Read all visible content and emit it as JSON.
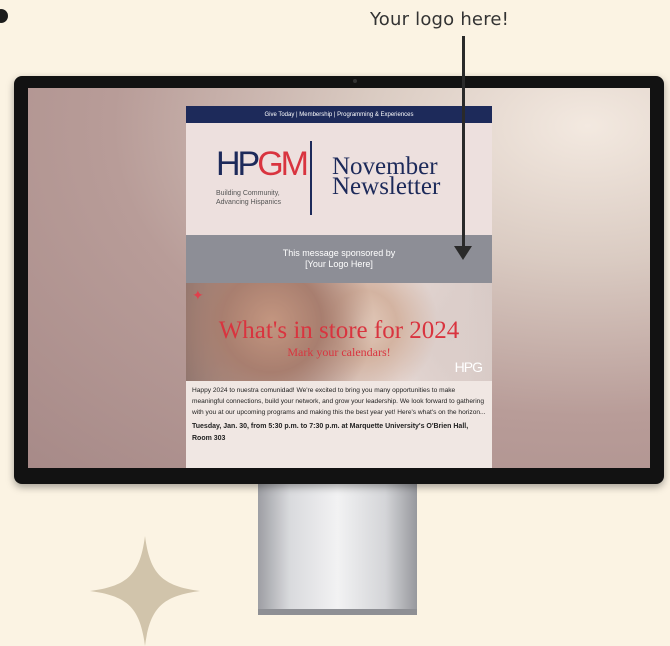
{
  "callout": {
    "text": "Your logo here!"
  },
  "newsletter": {
    "nav": "Give Today | Membership | Programming & Experiences",
    "logo": {
      "part1": "HP",
      "part2": "GM",
      "tagline": "Building Community, Advancing Hispanics"
    },
    "title_line1": "November",
    "title_line2": "Newsletter",
    "sponsor_line1": "This message sponsored by",
    "sponsor_line2": "[Your Logo Here]",
    "hero": {
      "headline": "What's in store for 2024",
      "subline": "Mark your calendars!",
      "logo": "HPG"
    },
    "body_text": "Happy 2024 to nuestra comunidad! We're excited to bring you many opportunities to make meaningful connections, build your network, and grow your leadership. We look forward to gathering with you at our upcoming programs and making this the best year yet! Here's what's on the horizon...",
    "event_text": "Tuesday, Jan. 30, from 5:30 p.m. to 7:30 p.m. at Marquette University's O'Brien Hall, Room 303"
  },
  "colors": {
    "navy": "#1d2a5a",
    "brand_red": "#d9343f",
    "background": "#fbf3e3",
    "sponsor_gray": "#8d8e96"
  },
  "icons": {
    "arrow": "down-arrow-icon",
    "sparkle": "sparkle-icon",
    "star": "four-point-star-icon"
  }
}
